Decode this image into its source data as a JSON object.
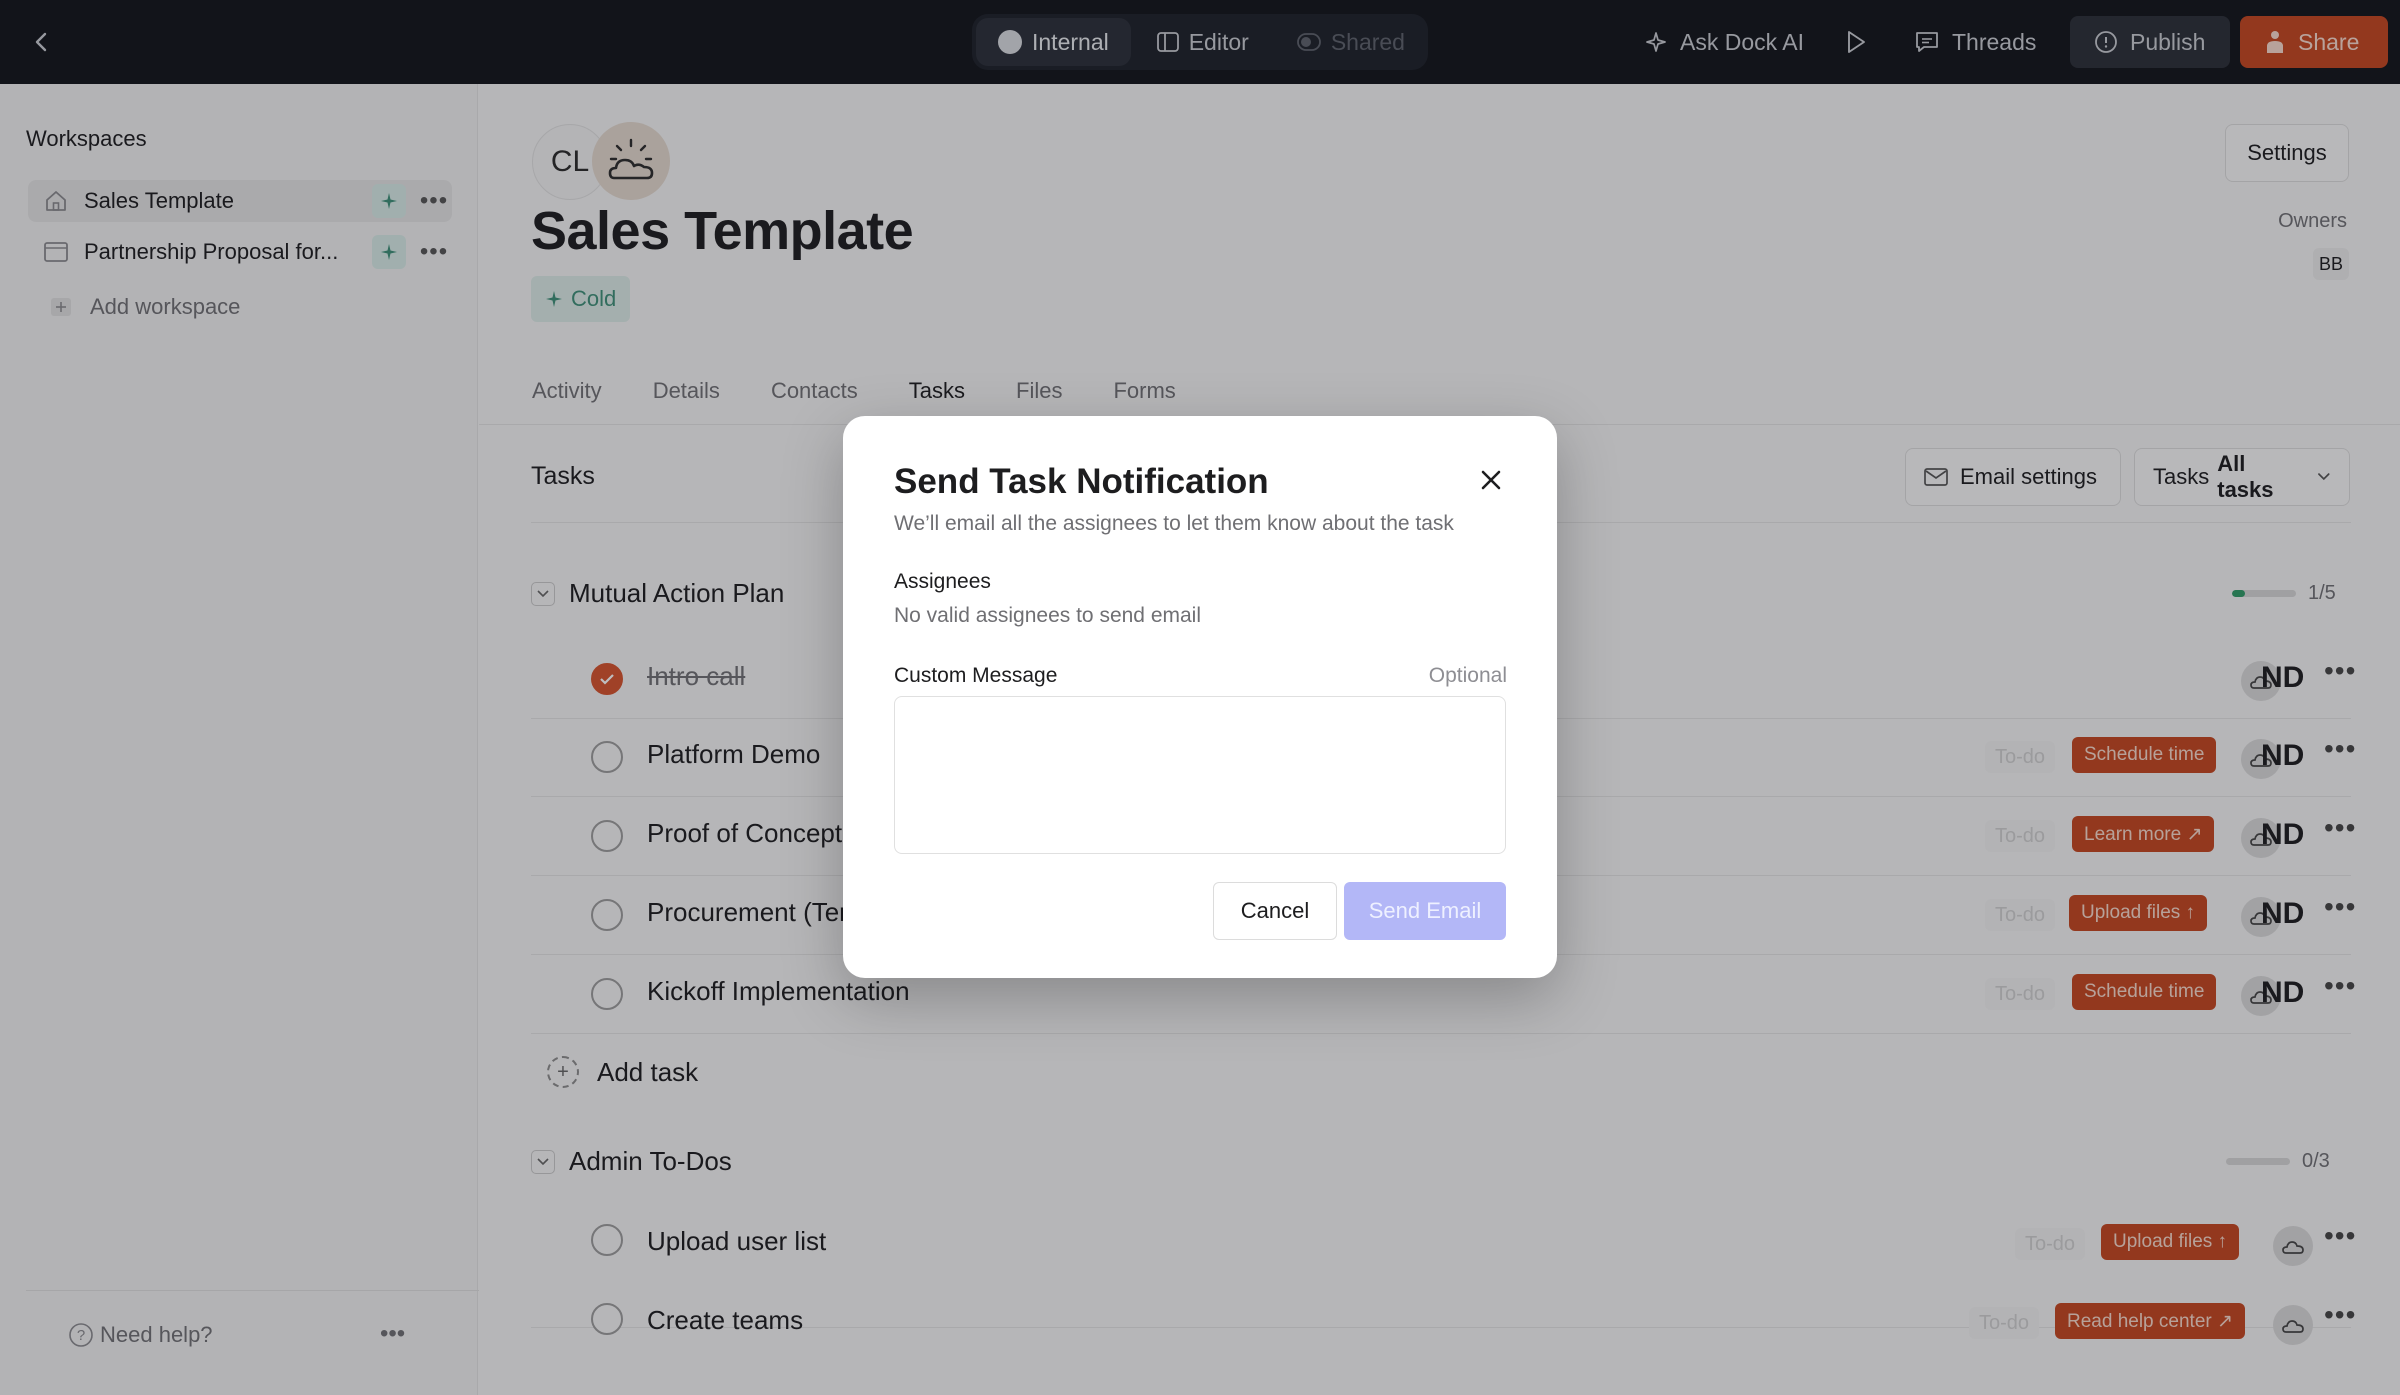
{
  "topbar": {
    "modes": [
      "Internal",
      "Editor",
      "Shared"
    ],
    "ask_ai": "Ask Dock AI",
    "threads": "Threads",
    "publish": "Publish",
    "share": "Share"
  },
  "sidebar": {
    "title": "Workspaces",
    "workspaces": [
      {
        "label": "Sales Template"
      },
      {
        "label": "Partnership Proposal for..."
      }
    ],
    "add_workspace": "Add workspace",
    "help": "Need help?"
  },
  "header": {
    "avatar_initials": "CL",
    "title": "Sales Template",
    "tag": "Cold",
    "settings": "Settings",
    "owners_label": "Owners",
    "owner_initials": "BB"
  },
  "tabs": [
    "Activity",
    "Details",
    "Contacts",
    "Tasks",
    "Files",
    "Forms"
  ],
  "tasks_section": {
    "title": "Tasks",
    "email_settings": "Email settings",
    "filter_prefix": "Tasks",
    "filter_value": "All tasks",
    "add_task": "Add task",
    "groups": [
      {
        "name": "Mutual Action Plan",
        "progress_text": "1/5",
        "progress": 0.2,
        "tasks": [
          {
            "name": "Intro call",
            "done": true,
            "status": "",
            "action": "",
            "assignee": "ND"
          },
          {
            "name": "Platform Demo",
            "done": false,
            "status": "To-do",
            "action": "Schedule time",
            "assignee": "ND"
          },
          {
            "name": "Proof of Concept",
            "done": false,
            "status": "To-do",
            "action": "Learn more ↗",
            "assignee": "ND"
          },
          {
            "name": "Procurement (Terr",
            "done": false,
            "status": "To-do",
            "action": "Upload files ↑",
            "assignee": "ND"
          },
          {
            "name": "Kickoff Implementation",
            "done": false,
            "status": "To-do",
            "action": "Schedule time",
            "assignee": "ND"
          }
        ]
      },
      {
        "name": "Admin To-Dos",
        "progress_text": "0/3",
        "progress": 0,
        "tasks": [
          {
            "name": "Upload user list",
            "done": false,
            "status": "To-do",
            "action": "Upload files ↑",
            "assignee": ""
          },
          {
            "name": "Create teams",
            "done": false,
            "status": "To-do",
            "action": "Read help center ↗",
            "assignee": ""
          }
        ]
      }
    ]
  },
  "modal": {
    "title": "Send Task Notification",
    "subtitle": "We’ll email all the assignees to let them know about the task",
    "assignees_label": "Assignees",
    "assignees_note": "No valid assignees to send email",
    "message_label": "Custom Message",
    "message_optional": "Optional",
    "message_value": "",
    "cancel": "Cancel",
    "send": "Send Email"
  },
  "colors": {
    "accent": "#c4461f",
    "send_disabled": "#b3b7f7",
    "tag_green": "#3e8f78",
    "progress_green": "#2f9a66",
    "topbar": "#11141a"
  }
}
